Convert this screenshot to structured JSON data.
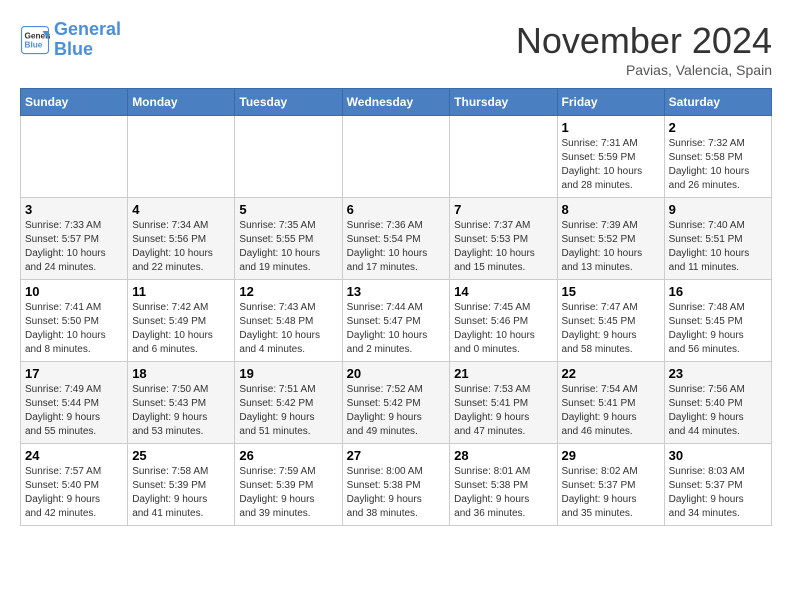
{
  "header": {
    "logo_line1": "General",
    "logo_line2": "Blue",
    "month": "November 2024",
    "location": "Pavias, Valencia, Spain"
  },
  "weekdays": [
    "Sunday",
    "Monday",
    "Tuesday",
    "Wednesday",
    "Thursday",
    "Friday",
    "Saturday"
  ],
  "weeks": [
    [
      {
        "day": "",
        "info": ""
      },
      {
        "day": "",
        "info": ""
      },
      {
        "day": "",
        "info": ""
      },
      {
        "day": "",
        "info": ""
      },
      {
        "day": "",
        "info": ""
      },
      {
        "day": "1",
        "info": "Sunrise: 7:31 AM\nSunset: 5:59 PM\nDaylight: 10 hours\nand 28 minutes."
      },
      {
        "day": "2",
        "info": "Sunrise: 7:32 AM\nSunset: 5:58 PM\nDaylight: 10 hours\nand 26 minutes."
      }
    ],
    [
      {
        "day": "3",
        "info": "Sunrise: 7:33 AM\nSunset: 5:57 PM\nDaylight: 10 hours\nand 24 minutes."
      },
      {
        "day": "4",
        "info": "Sunrise: 7:34 AM\nSunset: 5:56 PM\nDaylight: 10 hours\nand 22 minutes."
      },
      {
        "day": "5",
        "info": "Sunrise: 7:35 AM\nSunset: 5:55 PM\nDaylight: 10 hours\nand 19 minutes."
      },
      {
        "day": "6",
        "info": "Sunrise: 7:36 AM\nSunset: 5:54 PM\nDaylight: 10 hours\nand 17 minutes."
      },
      {
        "day": "7",
        "info": "Sunrise: 7:37 AM\nSunset: 5:53 PM\nDaylight: 10 hours\nand 15 minutes."
      },
      {
        "day": "8",
        "info": "Sunrise: 7:39 AM\nSunset: 5:52 PM\nDaylight: 10 hours\nand 13 minutes."
      },
      {
        "day": "9",
        "info": "Sunrise: 7:40 AM\nSunset: 5:51 PM\nDaylight: 10 hours\nand 11 minutes."
      }
    ],
    [
      {
        "day": "10",
        "info": "Sunrise: 7:41 AM\nSunset: 5:50 PM\nDaylight: 10 hours\nand 8 minutes."
      },
      {
        "day": "11",
        "info": "Sunrise: 7:42 AM\nSunset: 5:49 PM\nDaylight: 10 hours\nand 6 minutes."
      },
      {
        "day": "12",
        "info": "Sunrise: 7:43 AM\nSunset: 5:48 PM\nDaylight: 10 hours\nand 4 minutes."
      },
      {
        "day": "13",
        "info": "Sunrise: 7:44 AM\nSunset: 5:47 PM\nDaylight: 10 hours\nand 2 minutes."
      },
      {
        "day": "14",
        "info": "Sunrise: 7:45 AM\nSunset: 5:46 PM\nDaylight: 10 hours\nand 0 minutes."
      },
      {
        "day": "15",
        "info": "Sunrise: 7:47 AM\nSunset: 5:45 PM\nDaylight: 9 hours\nand 58 minutes."
      },
      {
        "day": "16",
        "info": "Sunrise: 7:48 AM\nSunset: 5:45 PM\nDaylight: 9 hours\nand 56 minutes."
      }
    ],
    [
      {
        "day": "17",
        "info": "Sunrise: 7:49 AM\nSunset: 5:44 PM\nDaylight: 9 hours\nand 55 minutes."
      },
      {
        "day": "18",
        "info": "Sunrise: 7:50 AM\nSunset: 5:43 PM\nDaylight: 9 hours\nand 53 minutes."
      },
      {
        "day": "19",
        "info": "Sunrise: 7:51 AM\nSunset: 5:42 PM\nDaylight: 9 hours\nand 51 minutes."
      },
      {
        "day": "20",
        "info": "Sunrise: 7:52 AM\nSunset: 5:42 PM\nDaylight: 9 hours\nand 49 minutes."
      },
      {
        "day": "21",
        "info": "Sunrise: 7:53 AM\nSunset: 5:41 PM\nDaylight: 9 hours\nand 47 minutes."
      },
      {
        "day": "22",
        "info": "Sunrise: 7:54 AM\nSunset: 5:41 PM\nDaylight: 9 hours\nand 46 minutes."
      },
      {
        "day": "23",
        "info": "Sunrise: 7:56 AM\nSunset: 5:40 PM\nDaylight: 9 hours\nand 44 minutes."
      }
    ],
    [
      {
        "day": "24",
        "info": "Sunrise: 7:57 AM\nSunset: 5:40 PM\nDaylight: 9 hours\nand 42 minutes."
      },
      {
        "day": "25",
        "info": "Sunrise: 7:58 AM\nSunset: 5:39 PM\nDaylight: 9 hours\nand 41 minutes."
      },
      {
        "day": "26",
        "info": "Sunrise: 7:59 AM\nSunset: 5:39 PM\nDaylight: 9 hours\nand 39 minutes."
      },
      {
        "day": "27",
        "info": "Sunrise: 8:00 AM\nSunset: 5:38 PM\nDaylight: 9 hours\nand 38 minutes."
      },
      {
        "day": "28",
        "info": "Sunrise: 8:01 AM\nSunset: 5:38 PM\nDaylight: 9 hours\nand 36 minutes."
      },
      {
        "day": "29",
        "info": "Sunrise: 8:02 AM\nSunset: 5:37 PM\nDaylight: 9 hours\nand 35 minutes."
      },
      {
        "day": "30",
        "info": "Sunrise: 8:03 AM\nSunset: 5:37 PM\nDaylight: 9 hours\nand 34 minutes."
      }
    ]
  ]
}
